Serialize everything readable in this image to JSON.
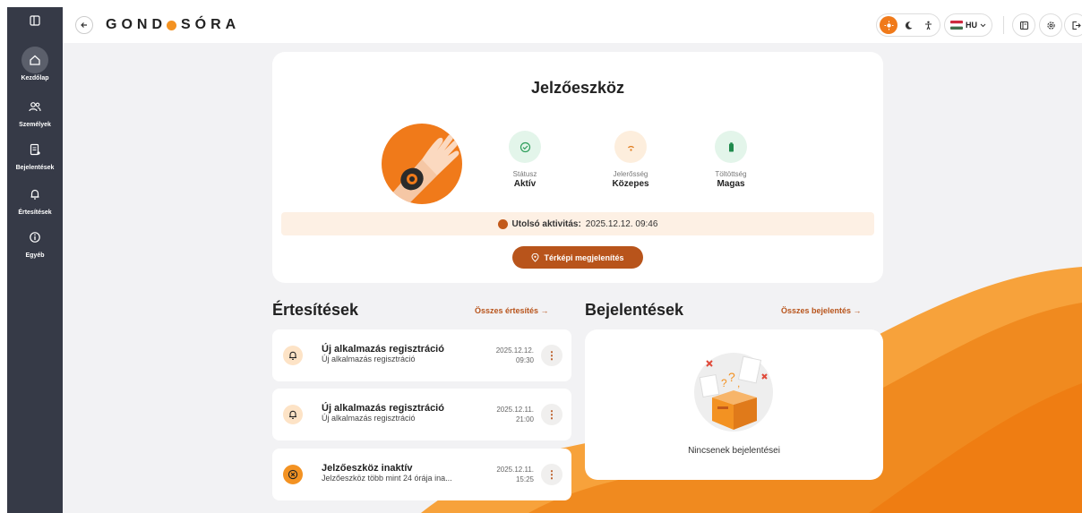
{
  "app": {
    "logo_text_a": "GOND",
    "logo_text_b": "SÓRA"
  },
  "sidebar": {
    "items": [
      {
        "label": "Kezdőlap",
        "icon": "home-icon",
        "active": true
      },
      {
        "label": "Személyek",
        "icon": "users-icon",
        "active": false
      },
      {
        "label": "Bejelentések",
        "icon": "report-icon",
        "active": false
      },
      {
        "label": "Értesítések",
        "icon": "bell-icon",
        "active": false
      },
      {
        "label": "Egyéb",
        "icon": "info-icon",
        "active": false
      }
    ]
  },
  "topbar": {
    "language": "HU",
    "icons": [
      "sun-icon",
      "moon-icon",
      "accessibility-icon",
      "flag-hu-icon",
      "manual-icon",
      "settings-icon",
      "logout-icon"
    ]
  },
  "device": {
    "title": "Jelzőeszköz",
    "stats": [
      {
        "label": "Státusz",
        "value": "Aktív",
        "icon": "check-circle-icon",
        "color": "#2e9e5b",
        "bg": "#e3f5ea"
      },
      {
        "label": "Jelerősség",
        "value": "Közepes",
        "icon": "signal-icon",
        "color": "#e07a1a",
        "bg": "#fdeedd"
      },
      {
        "label": "Töltöttség",
        "value": "Magas",
        "icon": "battery-icon",
        "color": "#2e9e5b",
        "bg": "#e3f5ea"
      }
    ],
    "activity_label": "Utolsó aktivitás:",
    "activity_value": "2025.12.12. 09:46",
    "map_button": "Térképi megjelenítés"
  },
  "notifications": {
    "title": "Értesítések",
    "link": "Összes értesítés →",
    "items": [
      {
        "title": "Új alkalmazás regisztráció",
        "subtitle": "Új alkalmazás regisztráció",
        "date": "2025.12.12.",
        "time": "09:30",
        "icon": "bell-icon",
        "icon_bg": "#fde3c6"
      },
      {
        "title": "Új alkalmazás regisztráció",
        "subtitle": "Új alkalmazás regisztráció",
        "date": "2025.12.11.",
        "time": "21:00",
        "icon": "bell-icon",
        "icon_bg": "#fde3c6"
      },
      {
        "title": "Jelzőeszköz inaktív",
        "subtitle": "Jelzőeszköz több mint 24 órája ina...",
        "date": "2025.12.11.",
        "time": "15:25",
        "icon": "x-circle-icon",
        "icon_bg": "#f39222"
      }
    ]
  },
  "reports": {
    "title": "Bejelentések",
    "link": "Összes bejelentés →",
    "empty_text": "Nincsenek bejelentései"
  },
  "colors": {
    "accent": "#f39222",
    "brand_dark": "#b8541b",
    "sidebar": "#363a47"
  }
}
